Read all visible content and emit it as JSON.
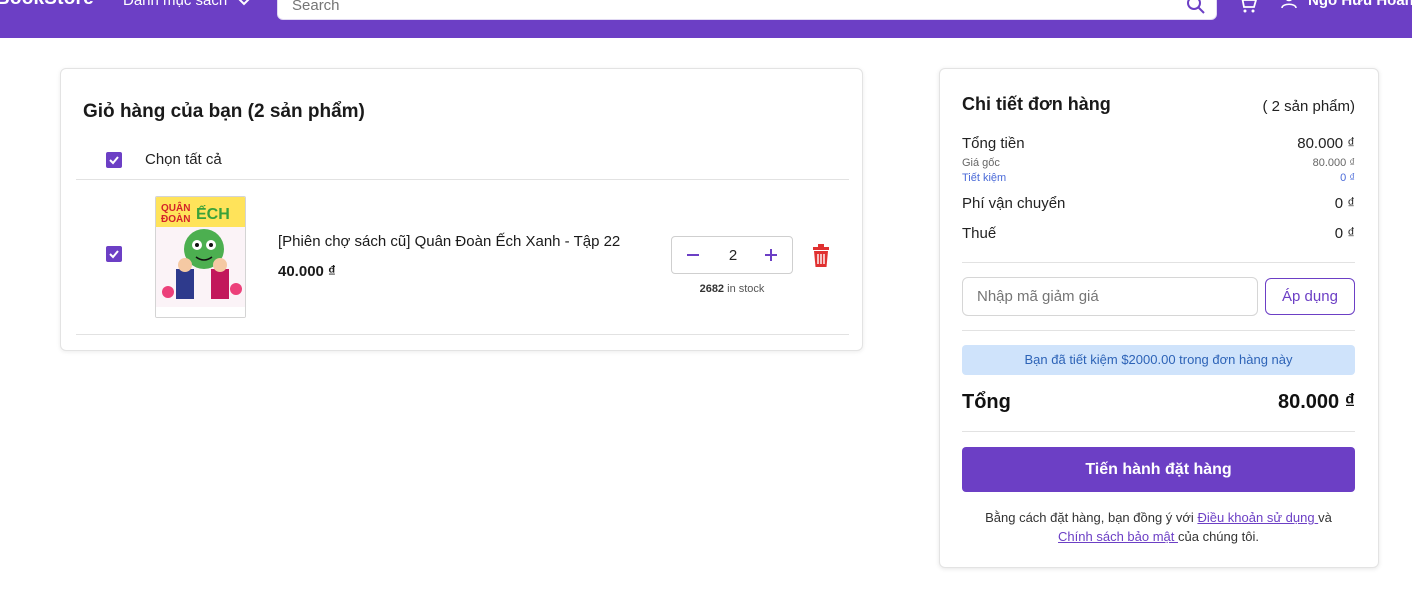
{
  "header": {
    "brand": "BookStore",
    "category_label": "Danh mục sách",
    "search_placeholder": "Search",
    "user_name": "Ngô Hữu Hoàn"
  },
  "cart": {
    "title": "Giỏ hàng của bạn (2 sản phẩm)",
    "select_all_label": "Chọn tất cả",
    "select_all_checked": true,
    "items": [
      {
        "checked": true,
        "cover_icon": "book-cover-image",
        "name": "[Phiên chợ sách cũ] Quân Đoàn Ếch Xanh - Tập 22",
        "price": "40.000 ₫",
        "quantity": "2",
        "stock_count": "2682",
        "stock_suffix": " in stock"
      }
    ]
  },
  "summary": {
    "title": "Chi tiết đơn hàng",
    "count": "( 2 sản phẩm)",
    "subtotal_label": "Tổng tiền",
    "subtotal_value": "80.000 ₫",
    "original_label": "Giá gốc",
    "original_value": "80.000 ₫",
    "savings_label": "Tiết kiệm",
    "savings_value": "0 ₫",
    "shipping_label": "Phí vận chuyển",
    "shipping_value": "0 ₫",
    "tax_label": "Thuế",
    "tax_value": "0 ₫",
    "promo_placeholder": "Nhập mã giảm giá",
    "apply_label": "Áp dụng",
    "savings_notice": "Bạn đã tiết kiệm $2000.00 trong đơn hàng này",
    "total_label": "Tổng",
    "total_value": "80.000 ₫",
    "order_button": "Tiến hành đặt hàng",
    "terms_prefix": "Bằng cách đặt hàng, bạn đồng ý với ",
    "terms_link": "Điều khoản sử dụng ",
    "terms_and": "và",
    "privacy_link": "Chính sách bảo mật ",
    "terms_suffix": "của chúng tôi."
  },
  "colors": {
    "brand_purple": "#6c3fc5",
    "notice_bg": "#cfe3fb",
    "notice_text": "#2d63b7",
    "delete_red": "#e03131"
  }
}
